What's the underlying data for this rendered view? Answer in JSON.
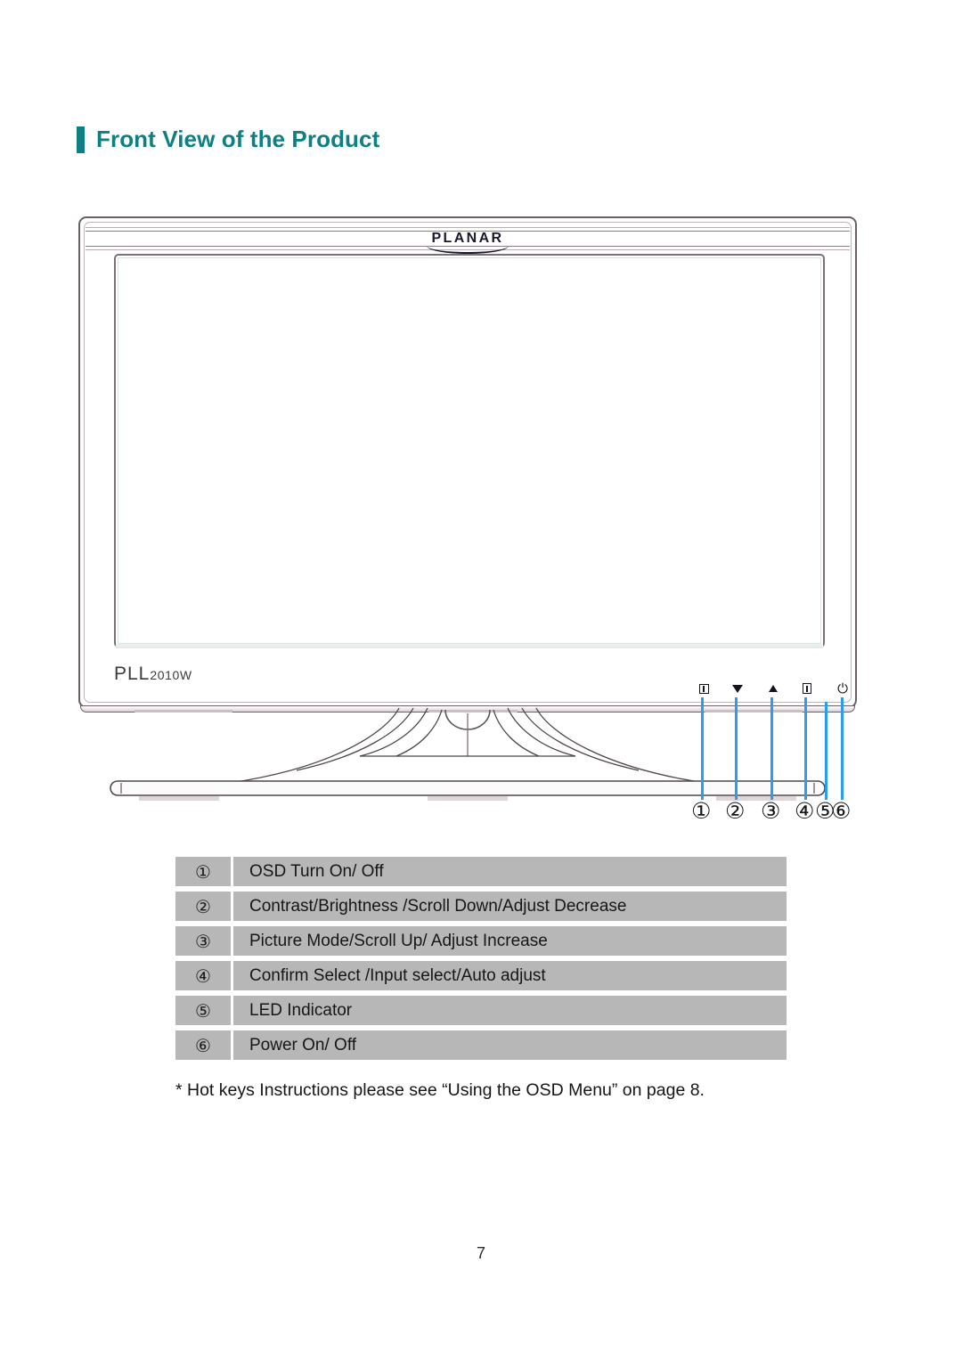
{
  "page": {
    "heading": "Front View of the Product",
    "heading_color": "#0d8085",
    "page_number": "7"
  },
  "monitor": {
    "brand_logo": "PLANAR",
    "model_prefix": "PLL",
    "model_suffix": "2010W",
    "leader_line_color": "#2b9cf0",
    "buttons": [
      {
        "id": "1",
        "icon": "osd-menu-icon",
        "marker": "①"
      },
      {
        "id": "2",
        "icon": "triangle-down-icon",
        "marker": "②"
      },
      {
        "id": "3",
        "icon": "triangle-up-icon",
        "marker": "③"
      },
      {
        "id": "4",
        "icon": "select-input-icon",
        "marker": "④"
      },
      {
        "id": "5",
        "icon": "led-indicator-icon",
        "marker": "⑤"
      },
      {
        "id": "6",
        "icon": "power-icon",
        "marker": "⑥",
        "glyph": "⏻"
      }
    ]
  },
  "legend": {
    "rows": [
      {
        "marker": "①",
        "description": "OSD Turn On/ Off"
      },
      {
        "marker": "②",
        "description": "Contrast/Brightness /Scroll Down/Adjust Decrease"
      },
      {
        "marker": "③",
        "description": "Picture Mode/Scroll Up/ Adjust Increase"
      },
      {
        "marker": "④",
        "description": "Confirm Select /Input select/Auto adjust"
      },
      {
        "marker": "⑤",
        "description": "LED Indicator"
      },
      {
        "marker": "⑥",
        "description": "Power On/ Off"
      }
    ]
  },
  "footnote": "* Hot keys Instructions please see “Using the OSD Menu” on page 8."
}
